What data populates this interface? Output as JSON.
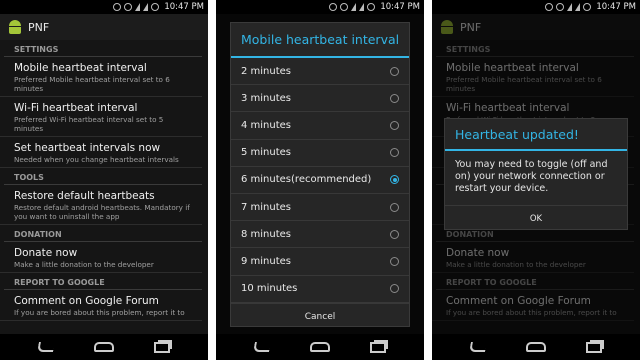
{
  "status_bar": {
    "time": "10:47 PM"
  },
  "app": {
    "title": "PNF"
  },
  "sections": [
    {
      "header": "SETTINGS",
      "prefs": [
        {
          "title": "Mobile heartbeat interval",
          "summary": "Preferred Mobile heartbeat interval set to 6 minutes"
        },
        {
          "title": "Wi-Fi heartbeat interval",
          "summary": "Preferred Wi-Fi heartbeat interval set to 5 minutes"
        },
        {
          "title": "Set heartbeat intervals now",
          "summary": "Needed when you change heartbeat intervals"
        }
      ]
    },
    {
      "header": "TOOLS",
      "prefs": [
        {
          "title": "Restore default heartbeats",
          "summary": "Restore default android heartbeats. Mandatory if you want to uninstall the app"
        }
      ]
    },
    {
      "header": "DONATION",
      "prefs": [
        {
          "title": "Donate now",
          "summary": "Make a little donation to the developer"
        }
      ]
    },
    {
      "header": "REPORT TO GOOGLE",
      "prefs": [
        {
          "title": "Comment on Google Forum",
          "summary": "If you are bored about this problem, report it to"
        }
      ]
    }
  ],
  "interval_dialog": {
    "title": "Mobile heartbeat interval",
    "options": [
      "2 minutes",
      "3 minutes",
      "4 minutes",
      "5 minutes",
      "6 minutes(recommended)",
      "7 minutes",
      "8 minutes",
      "9 minutes",
      "10 minutes"
    ],
    "selected_index": 4,
    "cancel_label": "Cancel"
  },
  "alert_dialog": {
    "title": "Heartbeat updated!",
    "message": "You may need to toggle (off and on) your network connection or restart your device.",
    "ok_label": "OK"
  },
  "colors": {
    "accent": "#33b5e5",
    "android_green": "#a4c639",
    "background": "#151515"
  },
  "icons": {
    "status": [
      "sync-icon",
      "alarm-icon",
      "wifi-icon",
      "signal-icon",
      "battery-icon"
    ],
    "nav": [
      "back-icon",
      "home-icon",
      "recent-apps-icon"
    ]
  }
}
